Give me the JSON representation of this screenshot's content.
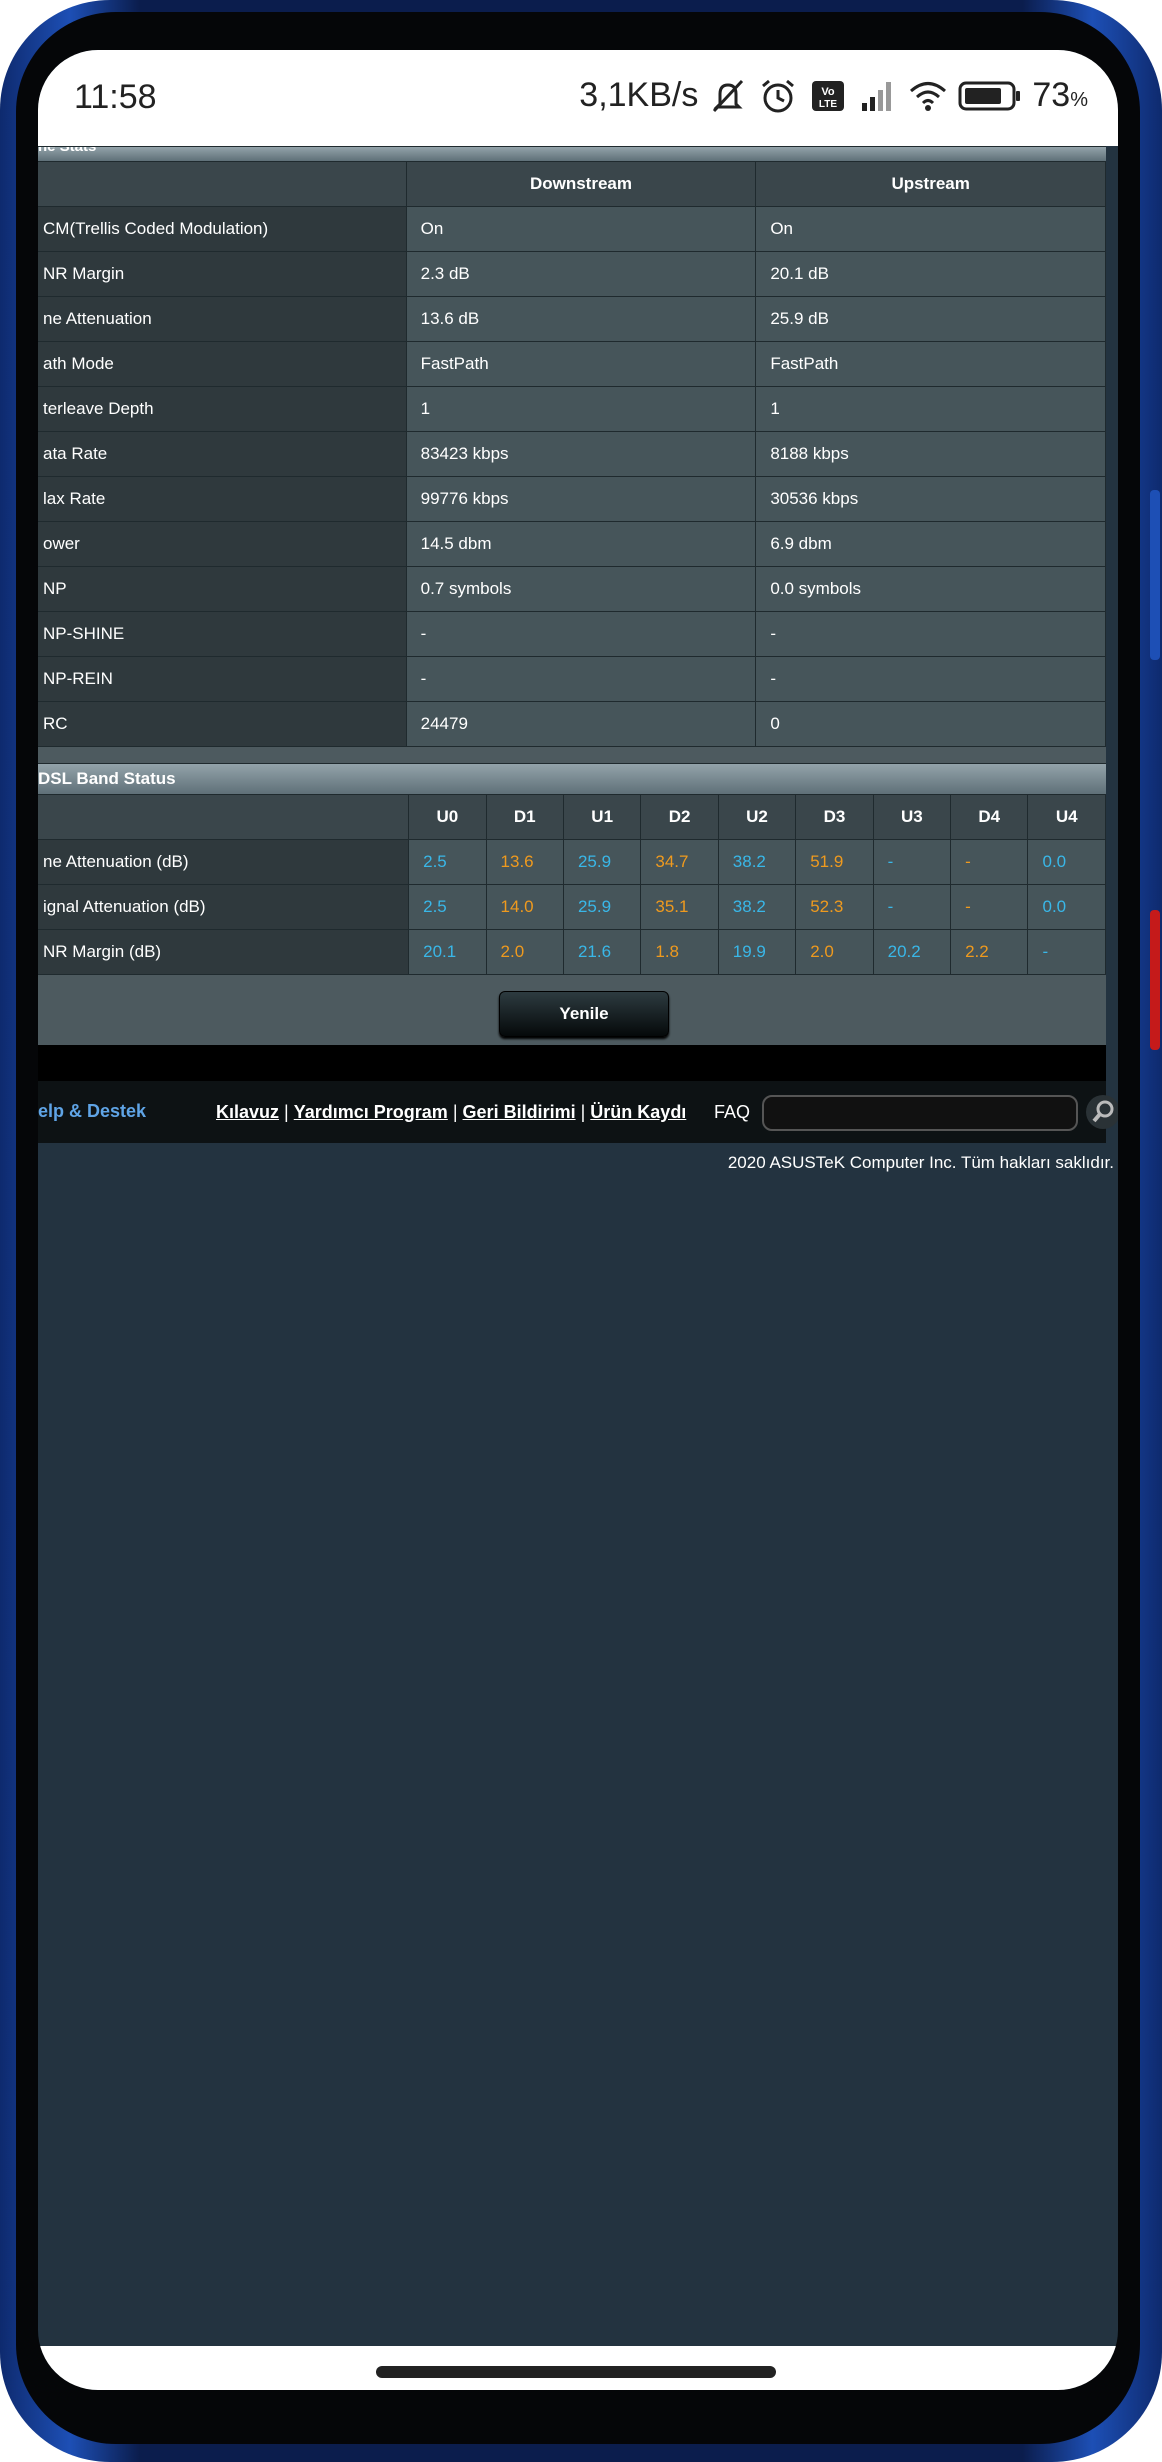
{
  "status_bar": {
    "time": "11:58",
    "speed": "3,1KB/s",
    "battery_pct": "73",
    "battery_unit": "%",
    "icons": [
      "mute-icon",
      "alarm-icon",
      "volte-icon",
      "signal-icon",
      "wifi-icon",
      "battery-icon"
    ]
  },
  "line_stats": {
    "partial_title": "ne Stats",
    "headers": [
      "",
      "Downstream",
      "Upstream"
    ],
    "rows": [
      {
        "label": "CM(Trellis Coded Modulation)",
        "down": "On",
        "up": "On"
      },
      {
        "label": "NR Margin",
        "down": "2.3 dB",
        "up": "20.1 dB"
      },
      {
        "label": "ne Attenuation",
        "down": "13.6 dB",
        "up": "25.9 dB"
      },
      {
        "label": "ath Mode",
        "down": "FastPath",
        "up": "FastPath"
      },
      {
        "label": "terleave Depth",
        "down": "1",
        "up": "1"
      },
      {
        "label": "ata Rate",
        "down": "83423 kbps",
        "up": "8188 kbps"
      },
      {
        "label": "lax Rate",
        "down": "99776 kbps",
        "up": "30536 kbps"
      },
      {
        "label": "ower",
        "down": "14.5 dbm",
        "up": "6.9 dbm"
      },
      {
        "label": "NP",
        "down": "0.7 symbols",
        "up": "0.0 symbols"
      },
      {
        "label": "NP-SHINE",
        "down": "-",
        "up": "-"
      },
      {
        "label": "NP-REIN",
        "down": "-",
        "up": "-"
      },
      {
        "label": "RC",
        "down": "24479",
        "up": "0"
      }
    ]
  },
  "band_status": {
    "title": "DSL Band Status",
    "bands": [
      "U0",
      "D1",
      "U1",
      "D2",
      "U2",
      "D3",
      "U3",
      "D4",
      "U4"
    ],
    "band_colors": {
      "U": "#39b7e8",
      "D": "#ef9a1e"
    },
    "rows": [
      {
        "label": "ne Attenuation (dB)",
        "values": [
          "2.5",
          "13.6",
          "25.9",
          "34.7",
          "38.2",
          "51.9",
          "-",
          "-",
          "0.0"
        ]
      },
      {
        "label": "ignal Attenuation (dB)",
        "values": [
          "2.5",
          "14.0",
          "25.9",
          "35.1",
          "38.2",
          "52.3",
          "-",
          "-",
          "0.0"
        ]
      },
      {
        "label": "NR Margin (dB)",
        "values": [
          "20.1",
          "2.0",
          "21.6",
          "1.8",
          "19.9",
          "2.0",
          "20.2",
          "2.2",
          "-"
        ]
      }
    ]
  },
  "refresh_button": "Yenile",
  "footer": {
    "help": "elp & Destek",
    "links": [
      "Kılavuz",
      "Yardımcı Program",
      "Geri Bildirimi",
      "Ürün Kaydı"
    ],
    "separator": "|",
    "faq": "FAQ",
    "copyright": "2020 ASUSTeK Computer Inc. Tüm hakları saklıdır."
  }
}
